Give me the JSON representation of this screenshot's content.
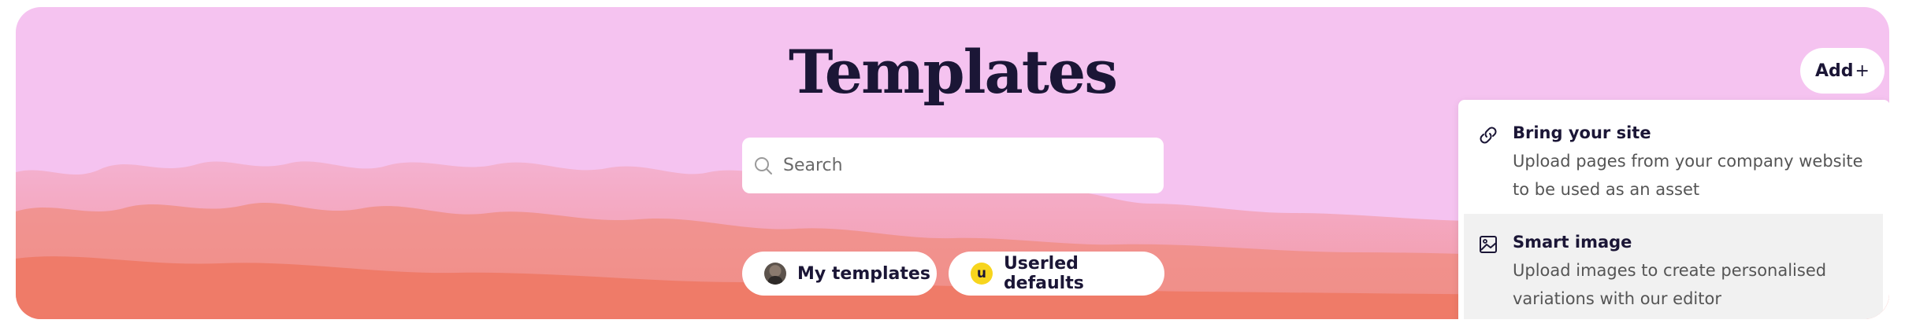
{
  "header": {
    "title": "Templates"
  },
  "search": {
    "placeholder": "Search",
    "value": ""
  },
  "filters": [
    {
      "label": "My templates",
      "icon": "user-avatar"
    },
    {
      "label": "Userled defaults",
      "icon": "userled-logo",
      "icon_text": "u"
    }
  ],
  "add_button": {
    "label": "Add",
    "suffix": "+"
  },
  "add_menu": {
    "items": [
      {
        "title": "Bring your site",
        "description": "Upload pages from your company website to be used as an asset",
        "icon": "link-icon"
      },
      {
        "title": "Smart image",
        "description": "Upload images to create personalised variations with our editor",
        "icon": "image-icon"
      }
    ]
  },
  "colors": {
    "hero_background": "#f5c3f0",
    "clouds": "#f07e6a",
    "title_text": "#1b1636",
    "userled_badge": "#f7d51d"
  }
}
